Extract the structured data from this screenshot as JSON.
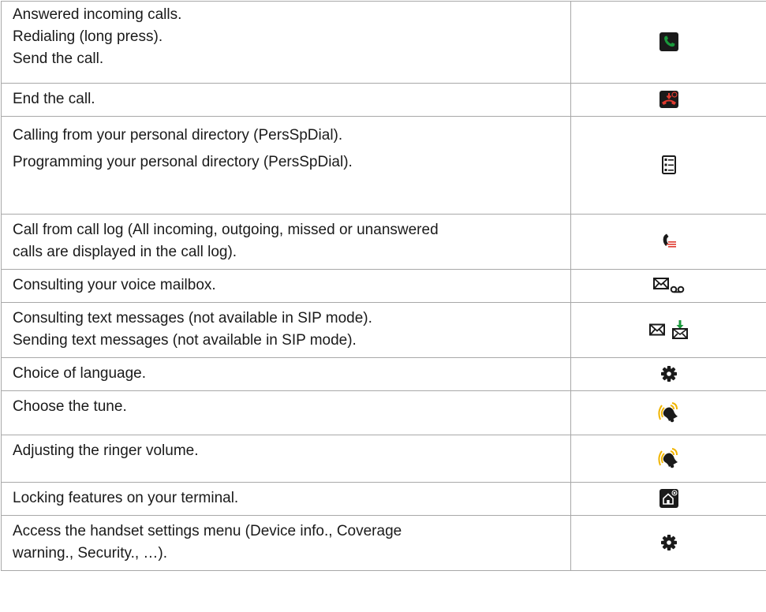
{
  "rows": [
    {
      "lines": [
        "Answered incoming calls.",
        "Redialing (long press).",
        "Send the call."
      ],
      "icon": "green-phone-icon"
    },
    {
      "lines": [
        "End the call."
      ],
      "icon": "red-hangup-icon"
    },
    {
      "lines": [
        "Calling from your personal directory (PersSpDial).",
        "Programming your personal directory (PersSpDial)."
      ],
      "icon": "directory-list-icon"
    },
    {
      "lines": [
        "Call from call log (All incoming, outgoing, missed or unanswered",
        "calls are displayed in the call log)."
      ],
      "icon": "call-log-icon"
    },
    {
      "lines": [
        "Consulting your voice mailbox."
      ],
      "icon": "envelope-voicemail-icon"
    },
    {
      "lines": [
        "Consulting text messages (not available in SIP mode).",
        "Sending text messages (not available in SIP mode)."
      ],
      "icon": "envelope-download-icon"
    },
    {
      "lines": [
        "Choice of language."
      ],
      "icon": "gear-icon"
    },
    {
      "lines": [
        "Choose the tune."
      ],
      "icon": "ringing-bell-icon"
    },
    {
      "lines": [
        "Adjusting the ringer volume."
      ],
      "icon": "ringing-bell-icon"
    },
    {
      "lines": [
        "Locking features on your terminal."
      ],
      "icon": "home-lock-icon"
    },
    {
      "lines": [
        "Access the handset settings menu (Device info., Coverage",
        "warning., Security., …)."
      ],
      "icon": "gear-icon"
    }
  ],
  "colors": {
    "border": "#a8a8a8",
    "green": "#1a9a3c",
    "red": "#e03a2f",
    "bell": "#f0b400",
    "dark": "#1a1a1a"
  }
}
